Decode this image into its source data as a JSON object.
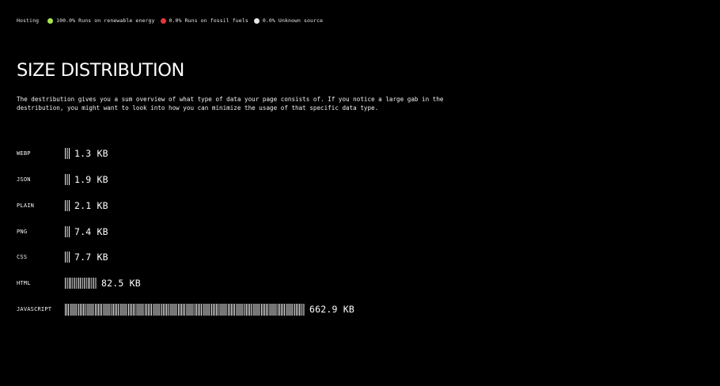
{
  "hosting": {
    "title": "Hosting",
    "items": [
      {
        "label": "100.0% Runs on renewable energy",
        "color": "#a6e44f"
      },
      {
        "label": "0.0% Runs on fossil fuels",
        "color": "#e8353a"
      },
      {
        "label": "0.0% Unknown source",
        "color": "#e6e6e6"
      }
    ]
  },
  "page_title": "SIZE DISTRIBUTION",
  "description": "The destribution gives you a sum overview of what type of data your page consists of. If you notice a large gab in the destribution, you might want to look into how you can minimize the usage of that specific data type.",
  "rows": [
    {
      "label": "WEBP",
      "value": "1.3 KB"
    },
    {
      "label": "JSON",
      "value": "1.9 KB"
    },
    {
      "label": "PLAIN",
      "value": "2.1 KB"
    },
    {
      "label": "PNG",
      "value": "7.4 KB"
    },
    {
      "label": "CSS",
      "value": "7.7 KB"
    },
    {
      "label": "HTML",
      "value": "82.5 KB"
    },
    {
      "label": "JAVASCRIPT",
      "value": "662.9 KB"
    }
  ]
}
